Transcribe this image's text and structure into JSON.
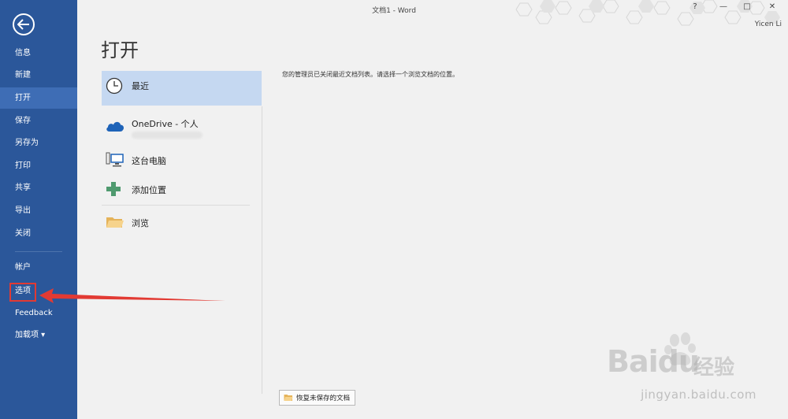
{
  "window": {
    "title": "文档1 - Word",
    "user": "Yicen Li",
    "help": "?",
    "minimize": "—",
    "restore": "□",
    "close": "✕"
  },
  "sidebar": {
    "items": [
      {
        "label": "信息"
      },
      {
        "label": "新建"
      },
      {
        "label": "打开"
      },
      {
        "label": "保存"
      },
      {
        "label": "另存为"
      },
      {
        "label": "打印"
      },
      {
        "label": "共享"
      },
      {
        "label": "导出"
      },
      {
        "label": "关闭"
      },
      {
        "label": "帐户"
      },
      {
        "label": "选项"
      },
      {
        "label": "Feedback"
      },
      {
        "label": "加载项 ▾"
      }
    ],
    "active_item": "打开"
  },
  "page": {
    "title": "打开",
    "locations": [
      {
        "label": "最近",
        "icon": "clock-icon"
      },
      {
        "label": "OneDrive - 个人",
        "icon": "cloud-icon"
      },
      {
        "label": "这台电脑",
        "icon": "computer-icon"
      },
      {
        "label": "添加位置",
        "icon": "plus-icon"
      },
      {
        "label": "浏览",
        "icon": "folder-icon"
      }
    ],
    "message": "您的管理员已关闭最近文档列表。请选择一个浏览文档的位置。",
    "recover_button": "恢复未保存的文档"
  },
  "watermark": {
    "brand": "Bai",
    "brand2": "du",
    "cn": "经验",
    "url": "jingyan.baidu.com"
  },
  "colors": {
    "sidebar": "#2b579a",
    "sidebar_active": "#3e6db5",
    "selected_location": "#c5d8f1",
    "annotation": "#e23a33"
  }
}
